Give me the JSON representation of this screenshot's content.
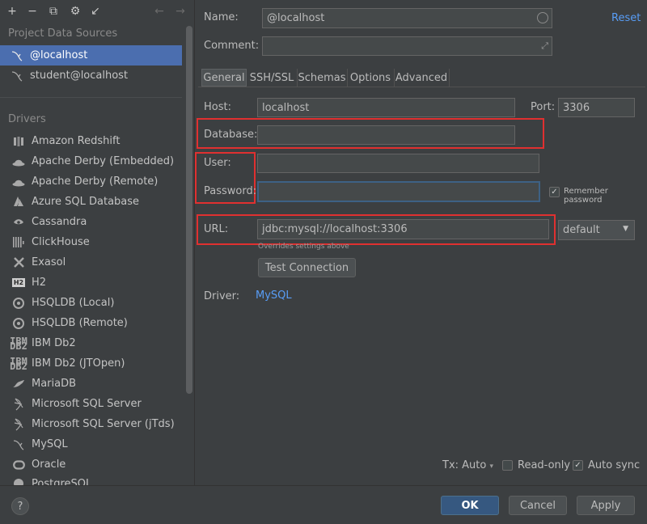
{
  "toolbar": {
    "add": "+",
    "remove": "−",
    "duplicate": "⧉",
    "wrench": "⚙",
    "import": "↙",
    "back": "←",
    "forward": "→"
  },
  "left": {
    "project_title": "Project Data Sources",
    "data_sources": [
      {
        "label": "@localhost",
        "icon": "mysql-dolphin-icon"
      },
      {
        "label": "student@localhost",
        "icon": "mysql-dolphin-icon"
      }
    ],
    "drivers_title": "Drivers",
    "drivers": [
      {
        "label": "Amazon Redshift",
        "icon": "redshift-icon"
      },
      {
        "label": "Apache Derby (Embedded)",
        "icon": "derby-hat-icon"
      },
      {
        "label": "Apache Derby (Remote)",
        "icon": "derby-hat-icon"
      },
      {
        "label": "Azure SQL Database",
        "icon": "azure-icon"
      },
      {
        "label": "Cassandra",
        "icon": "cassandra-eye-icon"
      },
      {
        "label": "ClickHouse",
        "icon": "clickhouse-bars-icon"
      },
      {
        "label": "Exasol",
        "icon": "exasol-x-icon"
      },
      {
        "label": "H2",
        "icon": "h2-icon"
      },
      {
        "label": "HSQLDB (Local)",
        "icon": "hsqldb-icon"
      },
      {
        "label": "HSQLDB (Remote)",
        "icon": "hsqldb-icon"
      },
      {
        "label": "IBM Db2",
        "icon": "ibm-db2-icon"
      },
      {
        "label": "IBM Db2 (JTOpen)",
        "icon": "ibm-db2-icon"
      },
      {
        "label": "MariaDB",
        "icon": "mariadb-seal-icon"
      },
      {
        "label": "Microsoft SQL Server",
        "icon": "sql-server-icon"
      },
      {
        "label": "Microsoft SQL Server (jTds)",
        "icon": "sql-server-icon"
      },
      {
        "label": "MySQL",
        "icon": "mysql-dolphin-icon"
      },
      {
        "label": "Oracle",
        "icon": "oracle-ring-icon"
      },
      {
        "label": "PostgreSQL",
        "icon": "postgresql-elephant-icon"
      }
    ]
  },
  "form": {
    "name_label": "Name:",
    "name_value": "@localhost",
    "reset": "Reset",
    "comment_label": "Comment:",
    "comment_value": "",
    "tabs": [
      "General",
      "SSH/SSL",
      "Schemas",
      "Options",
      "Advanced"
    ],
    "host_label": "Host:",
    "host_value": "localhost",
    "port_label": "Port:",
    "port_value": "3306",
    "database_label": "Database:",
    "database_value": "",
    "user_label": "User:",
    "user_value": "",
    "password_label": "Password:",
    "password_value": "",
    "remember_password": "Remember password",
    "url_label": "URL:",
    "url_value": "jdbc:mysql://localhost:3306",
    "url_mode": "default",
    "url_hint": "Overrides settings above",
    "test_connection": "Test Connection",
    "driver_label": "Driver:",
    "driver_value": "MySQL"
  },
  "options": {
    "tx_label": "Tx: Auto",
    "read_only": "Read-only",
    "auto_sync": "Auto sync"
  },
  "footer": {
    "help": "?",
    "ok": "OK",
    "cancel": "Cancel",
    "apply": "Apply"
  },
  "colors": {
    "background": "#3c3f41",
    "selection": "#4b6eaf",
    "link": "#589df6",
    "highlight_box": "#e03030",
    "primary_button": "#365880"
  }
}
